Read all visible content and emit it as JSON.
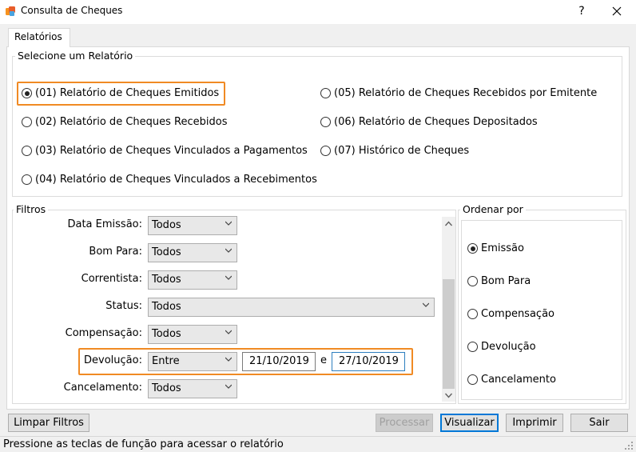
{
  "window": {
    "title": "Consulta de Cheques",
    "help": "?",
    "close": "✕"
  },
  "tabs": [
    {
      "label": "Relatórios",
      "active": true
    }
  ],
  "report_group": {
    "label": "Selecione um Relatório",
    "options": [
      {
        "label": "(01) Relatório de Cheques Emitidos",
        "checked": true
      },
      {
        "label": "(02) Relatório de Cheques Recebidos",
        "checked": false
      },
      {
        "label": "(03) Relatório de Cheques Vinculados a Pagamentos",
        "checked": false
      },
      {
        "label": "(04) Relatório de Cheques Vinculados a Recebimentos",
        "checked": false
      },
      {
        "label": "(05) Relatório de Cheques Recebidos por Emitente",
        "checked": false
      },
      {
        "label": "(06) Relatório de Cheques Depositados",
        "checked": false
      },
      {
        "label": "(07) Histórico de Cheques",
        "checked": false
      }
    ]
  },
  "filters": {
    "label": "Filtros",
    "data_emissao": {
      "label": "Data Emissão:",
      "value": "Todos"
    },
    "bom_para": {
      "label": "Bom Para:",
      "value": "Todos"
    },
    "correntista": {
      "label": "Correntista:",
      "value": "Todos"
    },
    "status": {
      "label": "Status:",
      "value": "Todos"
    },
    "compensacao": {
      "label": "Compensação:",
      "value": "Todos"
    },
    "devolucao": {
      "label": "Devolução:",
      "value": "Entre",
      "from": "21/10/2019",
      "connector": "e",
      "to": "27/10/2019"
    },
    "cancelamento": {
      "label": "Cancelamento:",
      "value": "Todos"
    }
  },
  "order": {
    "label": "Ordenar por",
    "options": [
      {
        "label": "Emissão",
        "checked": true
      },
      {
        "label": "Bom Para",
        "checked": false
      },
      {
        "label": "Compensação",
        "checked": false
      },
      {
        "label": "Devolução",
        "checked": false
      },
      {
        "label": "Cancelamento",
        "checked": false
      }
    ]
  },
  "buttons": {
    "limpar": "Limpar Filtros",
    "processar": "Processar",
    "visualizar": "Visualizar",
    "imprimir": "Imprimir",
    "sair": "Sair"
  },
  "status_text": "Pressione as teclas de função para acessar o relatório",
  "colors": {
    "highlight": "#f08a24",
    "focus": "#2e7fbf",
    "default_button": "#0078d7"
  },
  "icons": {
    "app": "checks-app-icon",
    "scroll_up": "arrow-up-icon",
    "scroll_down": "arrow-down-icon",
    "dropdown": "chevron-down-icon"
  }
}
